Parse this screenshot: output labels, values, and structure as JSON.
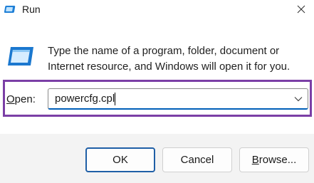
{
  "window": {
    "title": "Run",
    "close_glyph": "✕"
  },
  "description": "Type the name of a program, folder, document or Internet resource, and Windows will open it for you.",
  "open": {
    "label_mnemonic": "O",
    "label_rest": "pen:",
    "value": "powercfg.cpl"
  },
  "buttons": {
    "ok": "OK",
    "cancel": "Cancel",
    "browse_mnemonic": "B",
    "browse_rest": "rowse..."
  },
  "colors": {
    "highlight": "#7b3fa6",
    "accent": "#005fb8"
  },
  "icons": [
    "run-app-icon",
    "close-icon",
    "chevron-down-icon"
  ]
}
